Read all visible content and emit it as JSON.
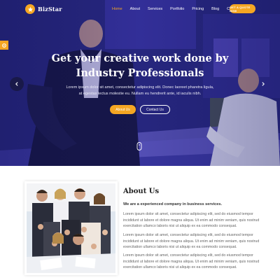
{
  "brand": {
    "name": "BizStar"
  },
  "nav": {
    "items": [
      {
        "label": "Home",
        "active": true
      },
      {
        "label": "About",
        "active": false
      },
      {
        "label": "Services",
        "active": false
      },
      {
        "label": "Portfolio",
        "active": false
      },
      {
        "label": "Pricing",
        "active": false
      },
      {
        "label": "Blog",
        "active": false
      },
      {
        "label": "Contact",
        "active": false
      }
    ],
    "cta_label": "GET A QUOTE NOW"
  },
  "hero": {
    "title_line1": "Get your creative work done by",
    "title_line2": "Industry Professionals",
    "desc_line1": "Lorem ipsum dolor sit amet, consectetur adipiscing elit. Donec laoreet pharetra ligula,",
    "desc_line2": "at egestas lectus molestie eu. Nullam eu hendrerit ante, id iaculis nibh.",
    "btn_about": "About Us",
    "btn_contact": "Contact Us"
  },
  "about": {
    "title": "About Us",
    "subtitle": "We are a experienced company in business services.",
    "para1_line1": "Lorem ipsum dolor sit amet, consectetur adipiscing elit, sed do eiusmod tempor",
    "para1_line2": "incididunt ut labore et dolore magna aliqua. Ut enim ad minim veniam, quis nostrud",
    "para1_line3": "exercitation ullamco laboris nisi ut aliquip ex ea commodo consequat.",
    "para2_line1": "Lorem ipsum dolor sit amet, consectetur adipiscing elit, sed do eiusmod tempor",
    "para2_line2": "incididunt ut labore et dolore magna aliqua. Ut enim ad minim veniam, quis nostrud",
    "para2_line3": "exercitation ullamco laboris nisi ut aliquip ex ea commodo consequat.",
    "para3_line1": "Lorem ipsum dolor sit amet, consectetur adipiscing elit, sed do eiusmod tempor",
    "para3_line2": "incididunt ut labore et dolore magna aliqua. Ut enim ad minim veniam, quis nostrud",
    "para3_line3": "exercitation ullamco laboris nisi ut aliquip ex ea commodo consequat."
  },
  "icons": {
    "logo": "star-badge-icon",
    "side_tab": "gear-icon",
    "prev": "chevron-left-icon",
    "next": "chevron-right-icon",
    "scroll": "mouse-scroll-icon"
  },
  "colors": {
    "accent": "#f5a623",
    "hero_overlay": "#2a2a8a",
    "active_nav": "#f5a623"
  }
}
